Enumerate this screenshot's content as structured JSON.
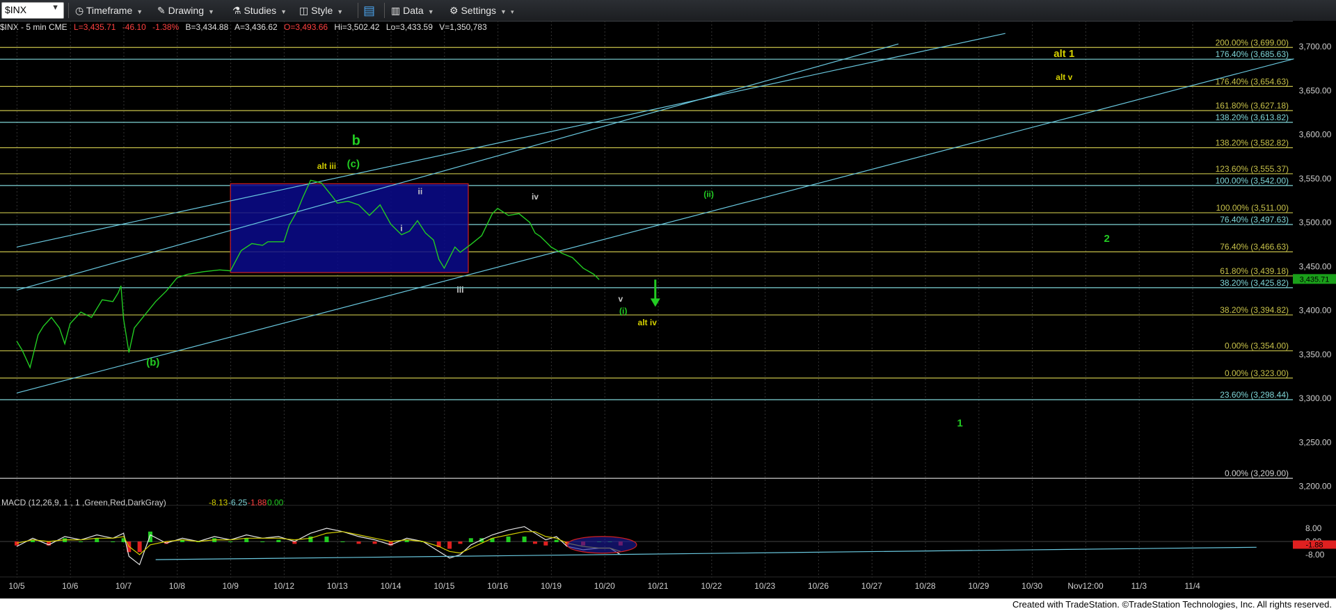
{
  "toolbar": {
    "symbol": "$INX",
    "timeframe": "Timeframe",
    "drawing": "Drawing",
    "studies": "Studies",
    "style": "Style",
    "data": "Data",
    "settings": "Settings"
  },
  "infobar": {
    "name": "$INX - 5 min  CME",
    "last": "L=3,435.71",
    "change": "-46.10",
    "change_pct": "-1.38%",
    "bid": "B=3,434.88",
    "ask": "A=3,436.62",
    "open": "O=3,493.66",
    "high": "Hi=3,502.42",
    "low": "Lo=3,433.59",
    "volume": "V=1,350,783"
  },
  "colors": {
    "background": "#000000",
    "price": "#22cc22",
    "fib_yellow": "#c8c24a",
    "fib_cyan": "#7fd6d8",
    "fib_white": "#d0d0d0",
    "channel": "#6ac9e0",
    "box_fill": "#0a0a8c",
    "box_border": "#d02020",
    "label_green": "#22cc22",
    "label_yellow": "#d4d000",
    "label_white": "#c8c8c8",
    "last_price_bg": "#1aa01a"
  },
  "chart_data": [
    {
      "type": "line",
      "title": "$INX - 5 min",
      "x_ticks": [
        "10/5",
        "10/6",
        "10/7",
        "10/8",
        "10/9",
        "10/12",
        "10/13",
        "10/14",
        "10/15",
        "10/16",
        "10/19",
        "10/20",
        "10/21",
        "10/22",
        "10/23",
        "10/26",
        "10/27",
        "10/28",
        "10/29",
        "10/30",
        "Nov12:00",
        "11/3",
        "11/4"
      ],
      "y_ticks": [
        "3,700.00",
        "3,650.00",
        "3,600.00",
        "3,550.00",
        "3,500.00",
        "3,450.00",
        "3,400.00",
        "3,350.00",
        "3,300.00",
        "3,250.00",
        "3,200.00"
      ],
      "ylim": [
        3180,
        3730
      ],
      "last_price": "3,435.71",
      "series": [
        {
          "x": [
            0,
            0.1,
            0.25,
            0.4,
            0.5,
            0.65,
            0.8,
            0.9,
            1.0,
            1.2,
            1.4,
            1.6,
            1.8,
            1.9,
            1.95,
            2.0,
            2.1,
            2.2,
            2.4,
            2.6,
            2.8,
            3.0,
            3.2,
            3.5,
            3.8,
            4.0,
            4.2,
            4.4,
            4.6,
            4.7,
            5.0,
            5.1,
            5.25,
            5.35,
            5.5,
            5.7,
            5.9,
            6.0,
            6.2,
            6.4,
            6.6,
            6.8,
            7.0,
            7.1,
            7.2,
            7.35,
            7.5,
            7.65,
            7.8,
            7.9,
            8.0,
            8.1,
            8.2,
            8.3,
            8.5,
            8.7,
            8.9,
            9.0,
            9.2,
            9.4,
            9.6,
            9.7,
            9.8,
            9.9,
            10.0,
            10.2,
            10.4,
            10.6,
            10.8,
            10.9
          ],
          "values": [
            3365,
            3355,
            3335,
            3372,
            3382,
            3392,
            3380,
            3362,
            3385,
            3398,
            3392,
            3412,
            3410,
            3420,
            3428,
            3390,
            3352,
            3380,
            3395,
            3410,
            3422,
            3437,
            3441,
            3444,
            3446,
            3445,
            3468,
            3476,
            3474,
            3478,
            3478,
            3497,
            3513,
            3528,
            3548,
            3545,
            3530,
            3522,
            3524,
            3520,
            3508,
            3520,
            3498,
            3492,
            3486,
            3490,
            3502,
            3488,
            3480,
            3458,
            3448,
            3460,
            3472,
            3466,
            3475,
            3485,
            3510,
            3516,
            3508,
            3510,
            3500,
            3488,
            3484,
            3478,
            3472,
            3465,
            3460,
            3448,
            3441,
            3435
          ]
        }
      ],
      "horizontal_levels": [
        {
          "label": "200.00% (3,699.00)",
          "value": 3699,
          "color": "#c8c24a"
        },
        {
          "label": "176.40% (3,685.63)",
          "value": 3685.63,
          "color": "#7fd6d8"
        },
        {
          "label": "176.40% (3,654.63)",
          "value": 3654.63,
          "color": "#c8c24a"
        },
        {
          "label": "161.80% (3,627.18)",
          "value": 3627.18,
          "color": "#c8c24a"
        },
        {
          "label": "138.20% (3,613.82)",
          "value": 3613.82,
          "color": "#7fd6d8"
        },
        {
          "label": "138.20% (3,582.82)",
          "value": 3585,
          "color": "#c8c24a"
        },
        {
          "label": "123.60% (3,555.37)",
          "value": 3555.37,
          "color": "#c8c24a"
        },
        {
          "label": "100.00% (3,542.00)",
          "value": 3542,
          "color": "#7fd6d8"
        },
        {
          "label": "100.00% (3,511.00)",
          "value": 3511,
          "color": "#c8c24a"
        },
        {
          "label": "76.40% (3,497.63)",
          "value": 3497.63,
          "color": "#7fd6d8"
        },
        {
          "label": "76.40% (3,466.63)",
          "value": 3466.63,
          "color": "#c8c24a"
        },
        {
          "label": "61.80% (3,439.18)",
          "value": 3439.18,
          "color": "#c8c24a"
        },
        {
          "label": "38.20% (3,425.82)",
          "value": 3425.82,
          "color": "#7fd6d8"
        },
        {
          "label": "38.20% (3,394.82)",
          "value": 3394.82,
          "color": "#c8c24a"
        },
        {
          "label": "0.00% (3,354.00)",
          "value": 3354,
          "color": "#c8c24a"
        },
        {
          "label": "0.00% (3,323.00)",
          "value": 3323,
          "color": "#c8c24a"
        },
        {
          "label": "23.60% (3,298.44)",
          "value": 3298.44,
          "color": "#7fd6d8"
        },
        {
          "label": "0.00% (3,209.00)",
          "value": 3209,
          "color": "#d0d0d0"
        }
      ],
      "box": {
        "x0": 4.0,
        "x1": 8.45,
        "y0": 3443,
        "y1": 3544
      },
      "trendlines": [
        {
          "x0": 0,
          "y0": 3423,
          "x1": 16.5,
          "y1": 3703
        },
        {
          "x0": 0,
          "y0": 3472,
          "x1": 18.5,
          "y1": 3715
        },
        {
          "x0": 0,
          "y0": 3306,
          "x1": 23.9,
          "y1": 3686
        }
      ],
      "wave_labels": [
        {
          "text": "b",
          "x": 6.35,
          "y": 3588,
          "color": "#22cc22",
          "size": 20
        },
        {
          "text": "(c)",
          "x": 6.3,
          "y": 3563,
          "color": "#22cc22",
          "size": 15
        },
        {
          "text": "alt iii",
          "x": 5.8,
          "y": 3561,
          "color": "#d4d000",
          "size": 12
        },
        {
          "text": "ii",
          "x": 7.55,
          "y": 3532,
          "color": "#c8c8c8",
          "size": 12
        },
        {
          "text": "i",
          "x": 7.2,
          "y": 3490,
          "color": "#c8c8c8",
          "size": 12
        },
        {
          "text": "iii",
          "x": 8.3,
          "y": 3420,
          "color": "#c8c8c8",
          "size": 12
        },
        {
          "text": "iv",
          "x": 9.7,
          "y": 3526,
          "color": "#c8c8c8",
          "size": 12
        },
        {
          "text": "v",
          "x": 11.3,
          "y": 3410,
          "color": "#c8c8c8",
          "size": 12
        },
        {
          "text": "(i)",
          "x": 11.35,
          "y": 3396,
          "color": "#22cc22",
          "size": 12
        },
        {
          "text": "alt iv",
          "x": 11.8,
          "y": 3383,
          "color": "#d4d000",
          "size": 12
        },
        {
          "text": "(ii)",
          "x": 12.95,
          "y": 3529,
          "color": "#22cc22",
          "size": 12
        },
        {
          "text": "(b)",
          "x": 2.55,
          "y": 3337,
          "color": "#22cc22",
          "size": 15
        },
        {
          "text": "alt 1",
          "x": 19.6,
          "y": 3688,
          "color": "#d4d000",
          "size": 15
        },
        {
          "text": "alt v",
          "x": 19.6,
          "y": 3662,
          "color": "#d4d000",
          "size": 12
        },
        {
          "text": "2",
          "x": 20.4,
          "y": 3478,
          "color": "#22cc22",
          "size": 15
        },
        {
          "text": "1",
          "x": 17.65,
          "y": 3268,
          "color": "#22cc22",
          "size": 15
        }
      ],
      "arrow": {
        "x": 11.95,
        "y_from": 3435,
        "y_to": 3412
      }
    },
    {
      "type": "line",
      "title": "MACD (12,26,9, 1 , 1 ,Green,Red,DarkGray)",
      "header_values": [
        "-8.13",
        "-6.25",
        "-1.88",
        "0.00"
      ],
      "y_ticks": [
        "8.00",
        "0.00",
        "-8.00"
      ],
      "current_value": "-1.88",
      "ylim": [
        -12,
        12
      ],
      "x": [
        0,
        0.3,
        0.6,
        0.9,
        1.2,
        1.5,
        1.8,
        2.0,
        2.1,
        2.3,
        2.5,
        2.8,
        3.1,
        3.4,
        3.7,
        4.0,
        4.3,
        4.6,
        4.9,
        5.2,
        5.5,
        5.8,
        6.1,
        6.4,
        6.7,
        7.0,
        7.3,
        7.6,
        7.9,
        8.1,
        8.3,
        8.5,
        8.7,
        8.9,
        9.2,
        9.5,
        9.7,
        9.9,
        10.1,
        10.3,
        10.6,
        10.9,
        11.1,
        11.3
      ],
      "macd": [
        -3,
        2,
        -2,
        3,
        1,
        4,
        2,
        5,
        -9,
        -14,
        4,
        -1,
        2,
        0,
        3,
        1,
        4,
        2,
        3,
        0,
        5,
        8,
        6,
        3,
        1,
        -2,
        2,
        0,
        -6,
        -10,
        -8,
        -2,
        1,
        4,
        7,
        9,
        5,
        1,
        3,
        -3,
        -5,
        -4,
        -4,
        -8
      ],
      "signal": [
        -1,
        1,
        0,
        1,
        1,
        2,
        2,
        3,
        -3,
        -8,
        -2,
        0,
        1,
        0,
        1,
        1,
        2,
        2,
        2,
        1,
        2,
        5,
        6,
        4,
        2,
        0,
        1,
        0,
        -3,
        -6,
        -7,
        -4,
        -1,
        2,
        4,
        6,
        6,
        3,
        2,
        -1,
        -3,
        -4,
        -4,
        -6
      ],
      "highlight_ellipse": {
        "x0": 10.3,
        "x1": 11.6
      },
      "trendline": {
        "x0": 2.6,
        "y0": -11,
        "x1": 23.2,
        "y1": -3.5
      }
    }
  ],
  "footer": "Created with TradeStation. ©TradeStation Technologies, Inc. All rights reserved."
}
